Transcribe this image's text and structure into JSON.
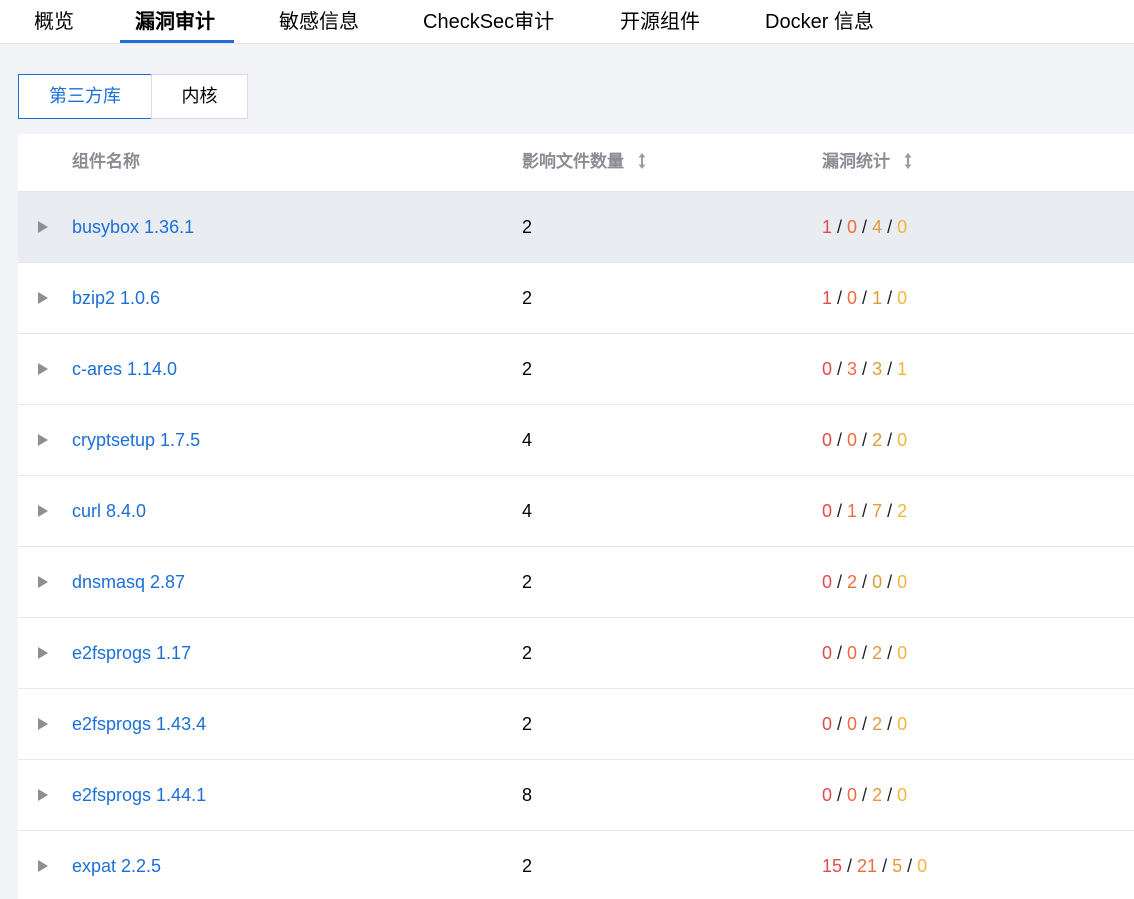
{
  "nav": {
    "tabs": [
      {
        "label": "概览",
        "active": false
      },
      {
        "label": "漏洞审计",
        "active": true
      },
      {
        "label": "敏感信息",
        "active": false
      },
      {
        "label": "CheckSec审计",
        "active": false
      },
      {
        "label": "开源组件",
        "active": false
      },
      {
        "label": "Docker 信息",
        "active": false
      }
    ]
  },
  "segment": {
    "options": [
      {
        "label": "第三方库",
        "active": true
      },
      {
        "label": "内核",
        "active": false
      }
    ]
  },
  "table": {
    "headers": {
      "name": "组件名称",
      "files": "影响文件数量",
      "vulns": "漏洞统计"
    },
    "severity_colors": [
      "#e14b4b",
      "#f06a3c",
      "#e39a3c",
      "#f2b63a"
    ],
    "rows": [
      {
        "name": "busybox 1.36.1",
        "files": "2",
        "stats": [
          "1",
          "0",
          "4",
          "0"
        ]
      },
      {
        "name": "bzip2 1.0.6",
        "files": "2",
        "stats": [
          "1",
          "0",
          "1",
          "0"
        ]
      },
      {
        "name": "c-ares 1.14.0",
        "files": "2",
        "stats": [
          "0",
          "3",
          "3",
          "1"
        ]
      },
      {
        "name": "cryptsetup 1.7.5",
        "files": "4",
        "stats": [
          "0",
          "0",
          "2",
          "0"
        ]
      },
      {
        "name": "curl 8.4.0",
        "files": "4",
        "stats": [
          "0",
          "1",
          "7",
          "2"
        ]
      },
      {
        "name": "dnsmasq 2.87",
        "files": "2",
        "stats": [
          "0",
          "2",
          "0",
          "0"
        ]
      },
      {
        "name": "e2fsprogs 1.17",
        "files": "2",
        "stats": [
          "0",
          "0",
          "2",
          "0"
        ]
      },
      {
        "name": "e2fsprogs 1.43.4",
        "files": "2",
        "stats": [
          "0",
          "0",
          "2",
          "0"
        ]
      },
      {
        "name": "e2fsprogs 1.44.1",
        "files": "8",
        "stats": [
          "0",
          "0",
          "2",
          "0"
        ]
      },
      {
        "name": "expat 2.2.5",
        "files": "2",
        "stats": [
          "15",
          "21",
          "5",
          "0"
        ]
      }
    ]
  }
}
